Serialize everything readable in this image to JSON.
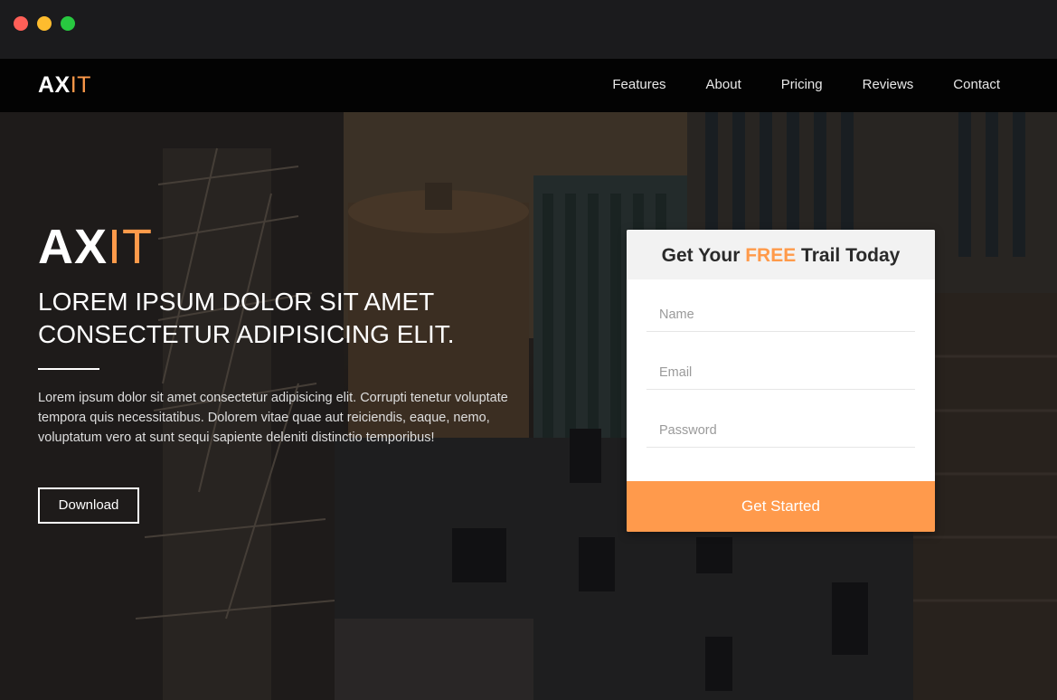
{
  "window": {
    "controls": [
      "close",
      "minimize",
      "maximize"
    ]
  },
  "nav": {
    "logo": {
      "part1": "AX",
      "part2": "IT"
    },
    "links": [
      "Features",
      "About",
      "Pricing",
      "Reviews",
      "Contact"
    ]
  },
  "hero": {
    "brand": {
      "part1": "AX",
      "part2": "IT"
    },
    "headline_line1": "LOREM IPSUM DOLOR SIT AMET",
    "headline_line2": "CONSECTETUR ADIPISICING ELIT.",
    "body": "Lorem ipsum dolor sit amet consectetur adipisicing elit. Corrupti tenetur voluptate tempora quis necessitatibus. Dolorem vitae quae aut reiciendis, eaque, nemo, voluptatum vero at sunt sequi sapiente deleniti distinctio temporibus!",
    "download_label": "Download"
  },
  "signup_form": {
    "title_pre": "Get Your ",
    "title_highlight": "FREE",
    "title_post": " Trail Today",
    "name_placeholder": "Name",
    "email_placeholder": "Email",
    "password_placeholder": "Password",
    "submit_label": "Get Started"
  },
  "colors": {
    "accent": "#ff9a4a",
    "nav_bg": "#030303",
    "chrome_bg": "#1b1b1d"
  }
}
